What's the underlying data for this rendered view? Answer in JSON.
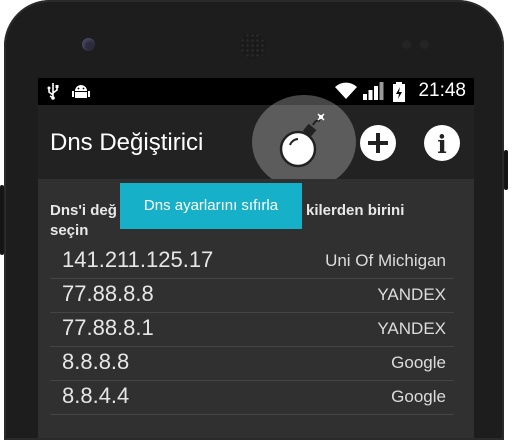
{
  "status_bar": {
    "usb_icon": "usb-icon",
    "android_icon": "android-debug-icon",
    "wifi_icon": "wifi-icon",
    "signal_icon": "signal-icon",
    "battery_icon": "battery-charging-icon",
    "time": "21:48"
  },
  "action_bar": {
    "title": "Dns Değiştirici",
    "actions": [
      {
        "name": "reset-dns-button",
        "icon": "bomb-icon"
      },
      {
        "name": "add-dns-button",
        "icon": "plus-circle-icon"
      },
      {
        "name": "info-button",
        "icon": "info-icon",
        "glyph": "i"
      }
    ]
  },
  "tooltip": "Dns ayarlarını sıfırla",
  "instruction": {
    "line1_start": "Dns'i değ",
    "line1_end": "kilerden birini",
    "line2": "seçin"
  },
  "dns_list": [
    {
      "ip": "141.211.125.17",
      "name": "Uni Of Michigan"
    },
    {
      "ip": "77.88.8.8",
      "name": "YANDEX"
    },
    {
      "ip": "77.88.8.1",
      "name": "YANDEX"
    },
    {
      "ip": "8.8.8.8",
      "name": "Google"
    },
    {
      "ip": "8.8.4.4",
      "name": "Google"
    }
  ],
  "colors": {
    "tooltip": "#17b0c9",
    "actionbar": "#222222",
    "content_bg": "#303030"
  }
}
